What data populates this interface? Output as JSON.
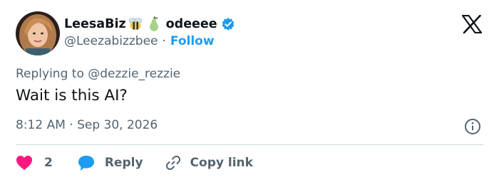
{
  "tweet": {
    "author": {
      "display_name_part1": "LeesaBiz",
      "display_name_part2": "odeeee",
      "name_emojis": [
        "bee-emoji",
        "pear-emoji"
      ],
      "handle": "@Leezabizzbee",
      "separator": "·",
      "follow_label": "Follow",
      "verified_badge": "verified-badge-icon",
      "verified_color": "#1d9bf0"
    },
    "replying_to": "Replying to @dezzie_rezzie",
    "text": "Wait is this AI?",
    "timestamp": "8:12 AM · Sep 30, 2026",
    "actions": {
      "like_count": "2",
      "reply_label": "Reply",
      "copy_link_label": "Copy link"
    },
    "colors": {
      "like": "#f91880",
      "accent": "#1d9bf0",
      "muted": "#536471",
      "text": "#0f1419"
    }
  }
}
